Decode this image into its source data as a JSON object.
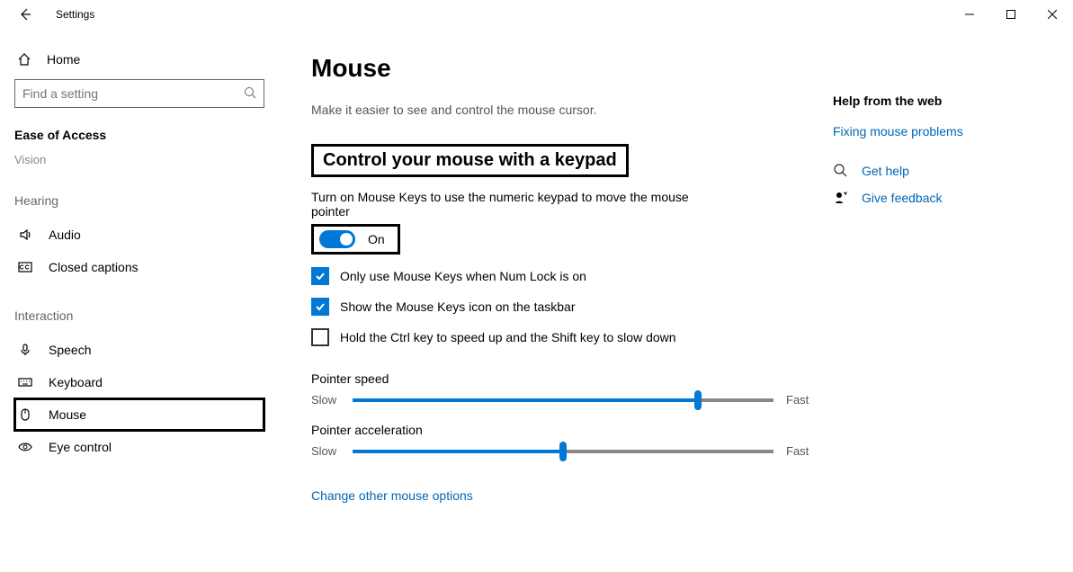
{
  "window": {
    "title": "Settings"
  },
  "sidebar": {
    "home": "Home",
    "search_placeholder": "Find a setting",
    "category": "Ease of Access",
    "vision_cut": "Vision",
    "hearing_title": "Hearing",
    "hearing_items": [
      {
        "label": "Audio"
      },
      {
        "label": "Closed captions"
      }
    ],
    "interaction_title": "Interaction",
    "interaction_items": [
      {
        "label": "Speech"
      },
      {
        "label": "Keyboard"
      },
      {
        "label": "Mouse"
      },
      {
        "label": "Eye control"
      }
    ]
  },
  "page": {
    "title": "Mouse",
    "description": "Make it easier to see and control the mouse cursor.",
    "section_header": "Control your mouse with a keypad",
    "toggle_desc": "Turn on Mouse Keys to use the numeric keypad to move the mouse pointer",
    "toggle_state": "On",
    "checks": [
      {
        "label": "Only use Mouse Keys when Num Lock is on",
        "checked": true
      },
      {
        "label": "Show the Mouse Keys icon on the taskbar",
        "checked": true
      },
      {
        "label": "Hold the Ctrl key to speed up and the Shift key to slow down",
        "checked": false
      }
    ],
    "sliders": [
      {
        "label": "Pointer speed",
        "low": "Slow",
        "high": "Fast",
        "value": 82
      },
      {
        "label": "Pointer acceleration",
        "low": "Slow",
        "high": "Fast",
        "value": 50
      }
    ],
    "other_link": "Change other mouse options"
  },
  "right": {
    "title": "Help from the web",
    "link1": "Fixing mouse problems",
    "help": "Get help",
    "feedback": "Give feedback"
  }
}
